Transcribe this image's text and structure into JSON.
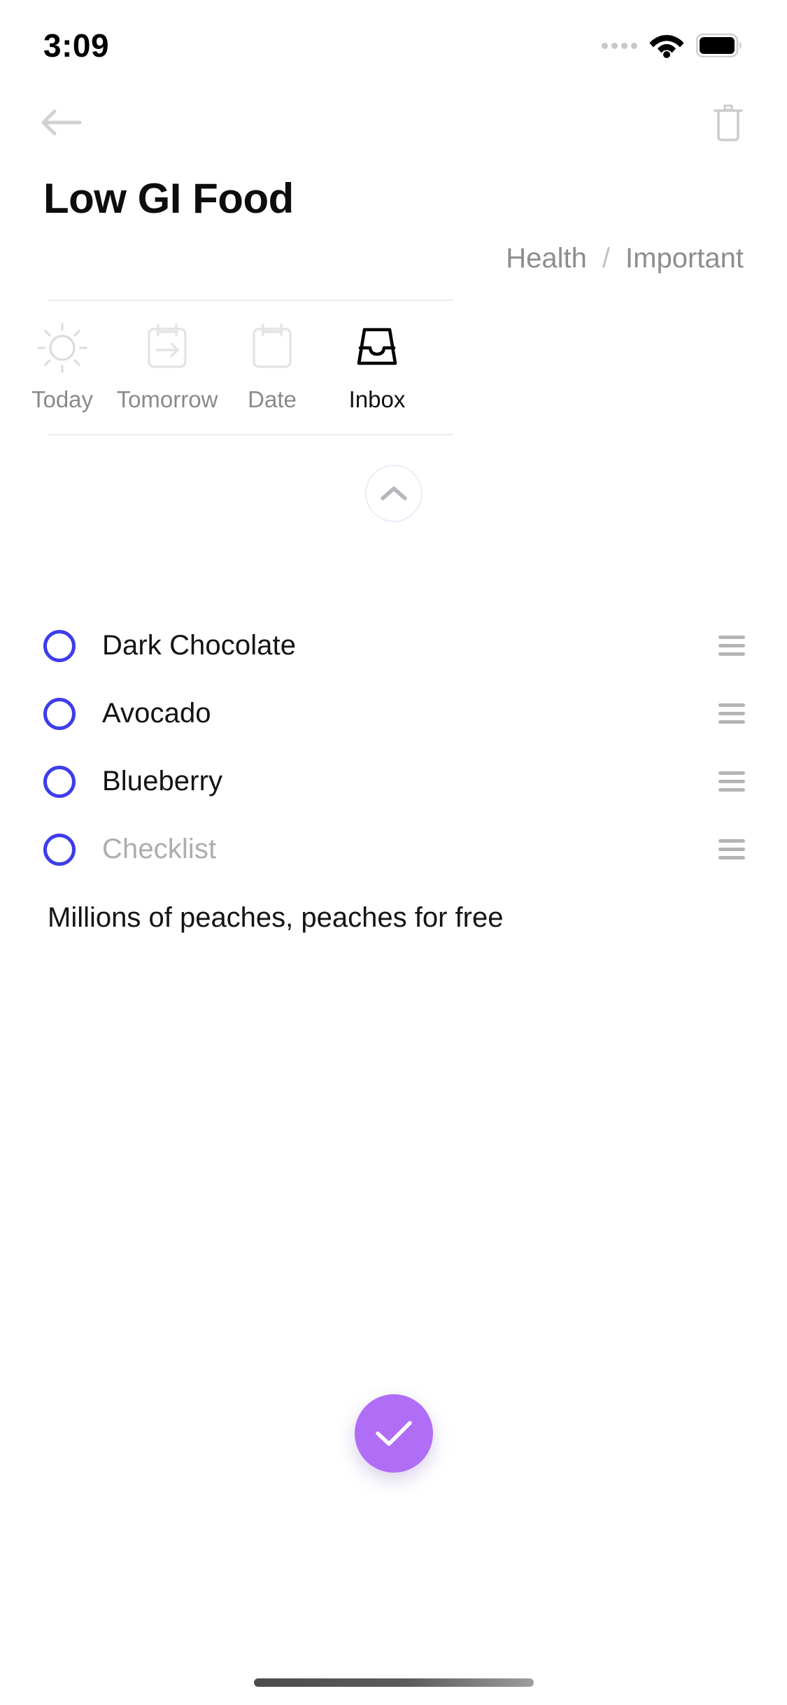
{
  "status_bar": {
    "time": "3:09",
    "icons": [
      "signal-dots-icon",
      "wifi-icon",
      "battery-icon"
    ]
  },
  "nav_bar": {
    "back_icon": "back-arrow-icon",
    "delete_icon": "trash-icon"
  },
  "task": {
    "title": "Low GI Food",
    "tags": {
      "list": "Health",
      "separator": "/",
      "priority": "Important"
    }
  },
  "schedule_tabs": [
    {
      "label": "Today",
      "icon": "sun-icon",
      "active": false
    },
    {
      "label": "Tomorrow",
      "icon": "calendar-arrow-icon",
      "active": false
    },
    {
      "label": "Date",
      "icon": "calendar-icon",
      "active": false
    },
    {
      "label": "Inbox",
      "icon": "inbox-tray-icon",
      "active": true
    }
  ],
  "collapse_button": {
    "icon": "chevron-up-icon"
  },
  "checklist": {
    "items": [
      {
        "label": "Dark Chocolate",
        "checked": false,
        "placeholder": false
      },
      {
        "label": "Avocado",
        "checked": false,
        "placeholder": false
      },
      {
        "label": "Blueberry",
        "checked": false,
        "placeholder": false
      },
      {
        "label": "Checklist",
        "checked": false,
        "placeholder": true
      }
    ]
  },
  "note": {
    "text": "Millions of peaches, peaches for free"
  },
  "fab": {
    "icon": "check-icon",
    "color": "#b06df5"
  },
  "colors": {
    "accent_purple": "#b06df5",
    "checkbox_blue": "#3d3deb",
    "muted_gray": "#8a8a8a",
    "icon_light_gray": "#dcdcdc",
    "divider": "#eeeeee"
  }
}
